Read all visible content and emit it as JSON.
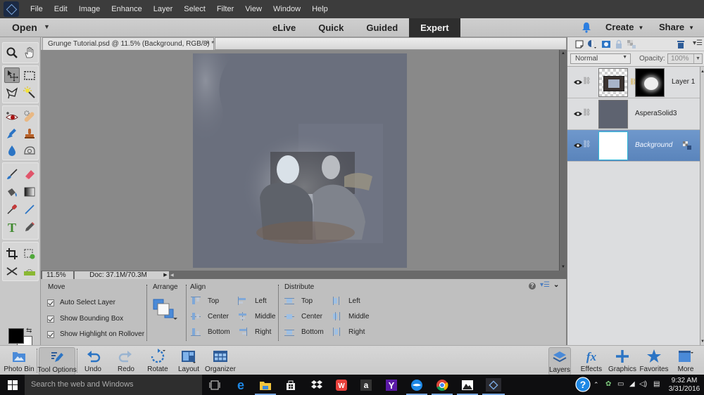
{
  "app": {
    "name": "Adobe Photoshop Elements",
    "menu": [
      "File",
      "Edit",
      "Image",
      "Enhance",
      "Layer",
      "Select",
      "Filter",
      "View",
      "Window",
      "Help"
    ]
  },
  "modebar": {
    "open_label": "Open",
    "tabs": [
      {
        "label": "eLive",
        "active": false
      },
      {
        "label": "Quick",
        "active": false
      },
      {
        "label": "Guided",
        "active": false
      },
      {
        "label": "Expert",
        "active": true
      }
    ],
    "create_label": "Create",
    "share_label": "Share",
    "notification_icon": "bell-icon"
  },
  "toolbox": {
    "tools": [
      {
        "name": "zoom-tool",
        "icon": "magnifier"
      },
      {
        "name": "hand-tool",
        "icon": "hand"
      },
      {
        "name": "move-tool",
        "icon": "move-arrows",
        "active": true
      },
      {
        "name": "rectangular-marquee-tool",
        "icon": "dashed-rectangle"
      },
      {
        "name": "lasso-tool",
        "icon": "lasso"
      },
      {
        "name": "magic-wand-tool",
        "icon": "magic-wand"
      },
      {
        "name": "red-eye-tool",
        "icon": "eye"
      },
      {
        "name": "spot-healing-brush-tool",
        "icon": "bandage"
      },
      {
        "name": "smart-brush-tool",
        "icon": "smart-brush"
      },
      {
        "name": "clone-stamp-tool",
        "icon": "stamp"
      },
      {
        "name": "blur-tool",
        "icon": "droplet"
      },
      {
        "name": "sponge-tool",
        "icon": "sponge"
      },
      {
        "name": "brush-tool",
        "icon": "brush"
      },
      {
        "name": "eraser-tool",
        "icon": "eraser"
      },
      {
        "name": "paint-bucket-tool",
        "icon": "bucket"
      },
      {
        "name": "gradient-tool",
        "icon": "gradient"
      },
      {
        "name": "eyedropper-tool",
        "icon": "eyedropper"
      },
      {
        "name": "line-tool",
        "icon": "line"
      },
      {
        "name": "type-tool",
        "icon": "T"
      },
      {
        "name": "pencil-tool",
        "icon": "pencil"
      },
      {
        "name": "crop-tool",
        "icon": "crop"
      },
      {
        "name": "recompose-tool",
        "icon": "recompose"
      },
      {
        "name": "content-aware-move-tool",
        "icon": "cross-arrows"
      },
      {
        "name": "straighten-tool",
        "icon": "level"
      }
    ],
    "foreground_color": "#000000",
    "background_color": "#ffffff"
  },
  "document": {
    "tab_title": "Grunge Tutorial.psd @ 11.5% (Background, RGB/8) *",
    "zoom": "11.5%",
    "doc_size": "Doc: 37.1M/70.3M"
  },
  "tool_options": {
    "move": {
      "heading": "Move",
      "options": [
        {
          "label": "Auto Select Layer",
          "checked": true
        },
        {
          "label": "Show Bounding Box",
          "checked": true
        },
        {
          "label": "Show Highlight on Rollover",
          "checked": true
        }
      ]
    },
    "arrange": {
      "heading": "Arrange"
    },
    "align": {
      "heading": "Align",
      "col1": [
        "Top",
        "Center",
        "Bottom"
      ],
      "col2": [
        "Left",
        "Middle",
        "Right"
      ]
    },
    "distribute": {
      "heading": "Distribute",
      "col1": [
        "Top",
        "Center",
        "Bottom"
      ],
      "col2": [
        "Left",
        "Middle",
        "Right"
      ]
    }
  },
  "layers_panel": {
    "blend_mode": "Normal",
    "opacity_label": "Opacity:",
    "opacity_value": "100%",
    "layers": [
      {
        "name": "Layer 1",
        "visible": true,
        "has_mask": true,
        "selected": false
      },
      {
        "name": "AsperaSolid3",
        "visible": true,
        "has_mask": false,
        "selected": false
      },
      {
        "name": "Background",
        "visible": true,
        "has_mask": false,
        "selected": true,
        "locked": true
      }
    ]
  },
  "bottombar": {
    "left": [
      {
        "label": "Photo Bin"
      },
      {
        "label": "Tool Options",
        "active": true
      },
      {
        "label": "Undo"
      },
      {
        "label": "Redo"
      },
      {
        "label": "Rotate"
      },
      {
        "label": "Layout"
      },
      {
        "label": "Organizer"
      }
    ],
    "right": [
      {
        "label": "Layers",
        "active": true
      },
      {
        "label": "Effects"
      },
      {
        "label": "Graphics"
      },
      {
        "label": "Favorites"
      },
      {
        "label": "More"
      }
    ]
  },
  "taskbar": {
    "search_placeholder": "Search the web and Windows",
    "time": "9:32 AM",
    "date": "3/31/2016"
  },
  "colors": {
    "accent": "#5a84bb",
    "menubar": "#3c3c3c",
    "canvas_bg": "#898989",
    "image_bg": "#6a6f7d"
  }
}
